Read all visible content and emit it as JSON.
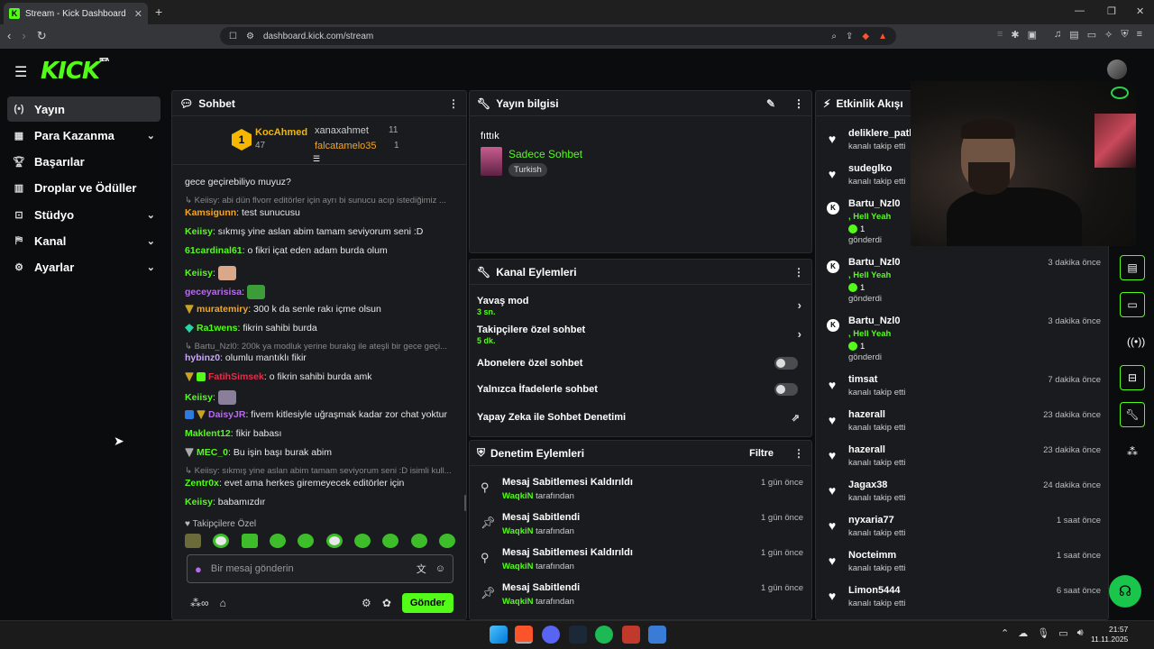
{
  "browser": {
    "tab_title": "Stream - Kick Dashboard",
    "url": "dashboard.kick.com/stream"
  },
  "app": {
    "logo": "KICK",
    "logo_badge": "BETA"
  },
  "sidebar": {
    "items": [
      {
        "label": "Yayın",
        "icon": "broadcast-icon",
        "active": true
      },
      {
        "label": "Para Kazanma",
        "icon": "wallet-icon"
      },
      {
        "label": "Başarılar",
        "icon": "trophy-icon"
      },
      {
        "label": "Droplar ve Ödüller",
        "icon": "gift-icon"
      },
      {
        "label": "Stüdyo",
        "icon": "studio-icon"
      },
      {
        "label": "Kanal",
        "icon": "channel-icon"
      },
      {
        "label": "Ayarlar",
        "icon": "gear-icon"
      }
    ]
  },
  "chat": {
    "title": "Sohbet",
    "leaderboard": {
      "first": {
        "rank": "1",
        "name": "KocAhmed",
        "count": "47"
      },
      "second": {
        "name": "xanaxahmet",
        "count": "11"
      },
      "third": {
        "name": "falcatamelo35",
        "count": "1"
      }
    },
    "messages": [
      {
        "user": "",
        "text": "gece geçirebiliyo muyuz?"
      },
      {
        "reply": "Keiisy: abi dün flvorr editörler için ayrı bi sunucu acıp istediğimiz ..."
      },
      {
        "user": "Kamsigunn",
        "color": "#f5a623",
        "text": ": test sunucusu"
      },
      {
        "user": "Keiisy",
        "color": "#53fc18",
        "text": ": sıkmış yine aslan abim tamam seviyorum seni :D"
      },
      {
        "user": "61cardinal61",
        "color": "#53fc18",
        "text": ": o fikri içat eden adam burda olum"
      },
      {
        "user": "Keiisy",
        "color": "#53fc18",
        "text": ":",
        "emote": true
      },
      {
        "user": "geceyarisisa",
        "color": "#b56ce8",
        "text": ":",
        "emote": true
      },
      {
        "user": "muratemiry",
        "color": "#f5a623",
        "text": ": 300 k da senle rakı içme olsun"
      },
      {
        "user": "Ra1wens",
        "color": "#53fc18",
        "text": ": fikrin sahibi burda"
      },
      {
        "reply": "Bartu_Nzl0: 200k ya modluk yerine burakg ile ateşli bir gece geçi..."
      },
      {
        "user": "hybinz0",
        "color": "#c9a7ff",
        "text": ": olumlu mantıklı fikir"
      },
      {
        "user": "FatihSimsek",
        "color": "#e0314b",
        "text": ": o fikrin sahibi burda amk"
      },
      {
        "user": "Keiisy",
        "color": "#53fc18",
        "text": ":",
        "emote": true
      },
      {
        "user": "DaisyJR",
        "color": "#b56ce8",
        "text": ": fivem kitlesiyle uğraşmak kadar zor chat yoktur"
      },
      {
        "user": "Maklent12",
        "color": "#53fc18",
        "text": ": fikir babası"
      },
      {
        "user": "MEC_0",
        "color": "#53fc18",
        "text": ": Bu işin başı burak abim"
      },
      {
        "reply": "Keiisy: sıkmış yine aslan abim tamam seviyorum seni :D isimli kull..."
      },
      {
        "user": "Zentr0x",
        "color": "#53fc18",
        "text": ": evet ama herkes giremeyecek editörler için"
      },
      {
        "user": "Keiisy",
        "color": "#53fc18",
        "text": ": babamızdır"
      }
    ],
    "follow_only_label": "Takipçilere Özel",
    "input_placeholder": "Bir mesaj gönderin",
    "send_label": "Gönder"
  },
  "stream_info": {
    "title": "Yayın bilgisi",
    "stream_title": "fıttık",
    "category": "Sadece Sohbet",
    "tag": "Turkish"
  },
  "channel_actions": {
    "title": "Kanal Eylemleri",
    "items": [
      {
        "label": "Yavaş mod",
        "sub": "3 sn."
      },
      {
        "label": "Takipçilere özel sohbet",
        "sub": "5 dk."
      },
      {
        "label": "Abonelere özel sohbet",
        "enabled": false
      },
      {
        "label": "Yalnızca İfadelerle sohbet",
        "enabled": false
      },
      {
        "label": "Yapay Zeka ile Sohbet Denetimi"
      }
    ]
  },
  "moderation": {
    "title": "Denetim Eylemleri",
    "filter_label": "Filtre",
    "items": [
      {
        "title": "Mesaj Sabitlemesi Kaldırıldı",
        "by_user": "WaqkiN",
        "by_suffix": " tarafından",
        "time": "1 gün önce",
        "icon": "unpin-icon"
      },
      {
        "title": "Mesaj Sabitlendi",
        "by_user": "WaqkiN",
        "by_suffix": " tarafından",
        "time": "1 gün önce",
        "icon": "pin-icon"
      },
      {
        "title": "Mesaj Sabitlemesi Kaldırıldı",
        "by_user": "WaqkiN",
        "by_suffix": " tarafından",
        "time": "1 gün önce",
        "icon": "unpin-icon"
      },
      {
        "title": "Mesaj Sabitlendi",
        "by_user": "WaqkiN",
        "by_suffix": " tarafından",
        "time": "1 gün önce",
        "icon": "pin-icon"
      }
    ]
  },
  "activity": {
    "title": "Etkinlik Akışı",
    "items": [
      {
        "name": "deliklere_patla",
        "sub": "kanalı takip etti",
        "time": ""
      },
      {
        "name": "sudeglko",
        "sub": "kanalı takip etti",
        "time": ""
      },
      {
        "name": "Bartu_Nzl0",
        "gift": ", Hell Yeah",
        "amount": "1",
        "sent": "gönderdi",
        "time": ""
      },
      {
        "name": "Bartu_Nzl0",
        "gift": ", Hell Yeah",
        "amount": "1",
        "sent": "gönderdi",
        "time": "3 dakika önce"
      },
      {
        "name": "Bartu_Nzl0",
        "gift": ", Hell Yeah",
        "amount": "1",
        "sent": "gönderdi",
        "time": "3 dakika önce"
      },
      {
        "name": "timsat",
        "sub": "kanalı takip etti",
        "time": "7 dakika önce"
      },
      {
        "name": "hazerall",
        "sub": "kanalı takip etti",
        "time": "23 dakika önce"
      },
      {
        "name": "hazerall",
        "sub": "kanalı takip etti",
        "time": "23 dakika önce"
      },
      {
        "name": "Jagax38",
        "sub": "kanalı takip etti",
        "time": "24 dakika önce"
      },
      {
        "name": "nyxaria77",
        "sub": "kanalı takip etti",
        "time": "1 saat önce"
      },
      {
        "name": "Nocteimm",
        "sub": "kanalı takip etti",
        "time": "1 saat önce"
      },
      {
        "name": "Limon5444",
        "sub": "kanalı takip etti",
        "time": "6 saat önce"
      }
    ]
  },
  "taskbar": {
    "time": "21:57",
    "date": "11.11.2025"
  },
  "colors": {
    "brand_green": "#53fc18",
    "panel_bg": "#191b1f",
    "page_bg": "#0b0c0e"
  }
}
